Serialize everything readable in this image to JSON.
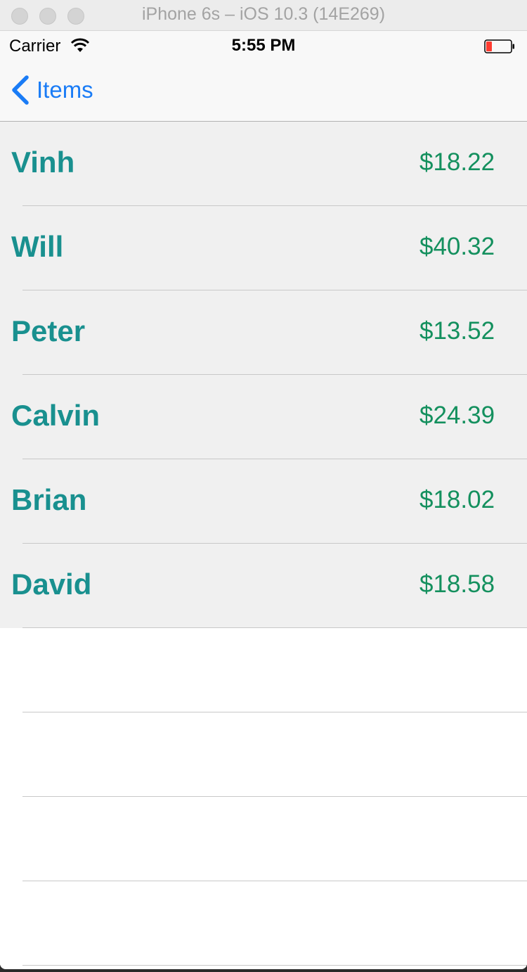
{
  "window": {
    "title": "iPhone 6s – iOS 10.3 (14E269)"
  },
  "status_bar": {
    "carrier": "Carrier",
    "time": "5:55 PM",
    "battery_color": "#ff3b30"
  },
  "nav": {
    "back_label": "Items",
    "tint": "#1a7cf6"
  },
  "rows": [
    {
      "name": "Vinh",
      "amount": "$18.22"
    },
    {
      "name": "Will",
      "amount": "$40.32"
    },
    {
      "name": "Peter",
      "amount": "$13.52"
    },
    {
      "name": "Calvin",
      "amount": "$24.39"
    },
    {
      "name": "Brian",
      "amount": "$18.02"
    },
    {
      "name": "David",
      "amount": "$18.58"
    }
  ],
  "colors": {
    "name_text": "#19908f",
    "amount_text": "#14905e",
    "row_background": "#f0f0f0"
  }
}
